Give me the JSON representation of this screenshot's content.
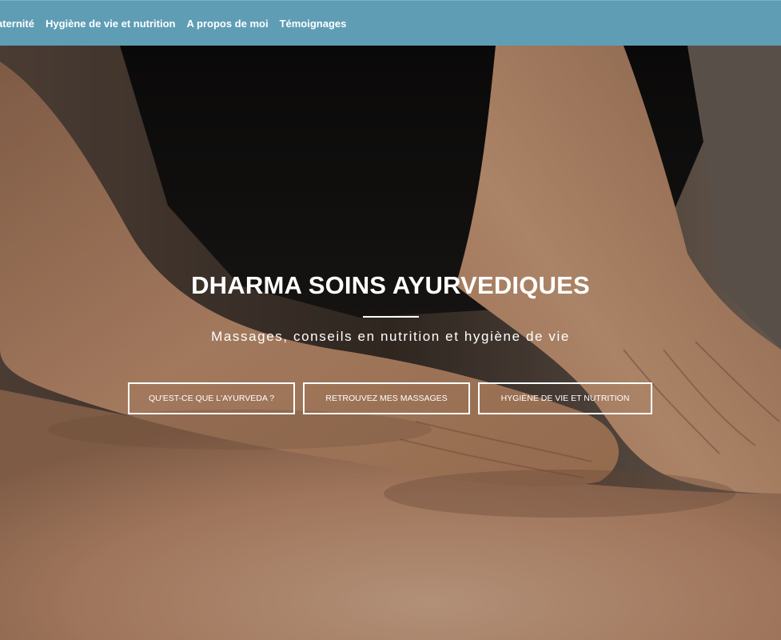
{
  "nav": {
    "items": [
      {
        "label": "aternité"
      },
      {
        "label": "Hygiène de vie et nutrition"
      },
      {
        "label": "A propos de moi"
      },
      {
        "label": "Témoignages"
      }
    ]
  },
  "hero": {
    "title": "DHARMA SOINS AYURVEDIQUES",
    "subtitle": "Massages, conseils en nutrition et hygiène de vie",
    "image": "massage-hands-photo",
    "buttons": [
      {
        "label": "QU'EST-CE QUE L'AYURVEDA ?"
      },
      {
        "label": "RETROUVEZ MES MASSAGES"
      },
      {
        "label": "HYGIÈNE DE VIE ET NUTRITION"
      }
    ]
  },
  "colors": {
    "navbar": "#5f9db5",
    "text": "#ffffff",
    "skin": "#c58f6a",
    "shirt": "#121110"
  }
}
